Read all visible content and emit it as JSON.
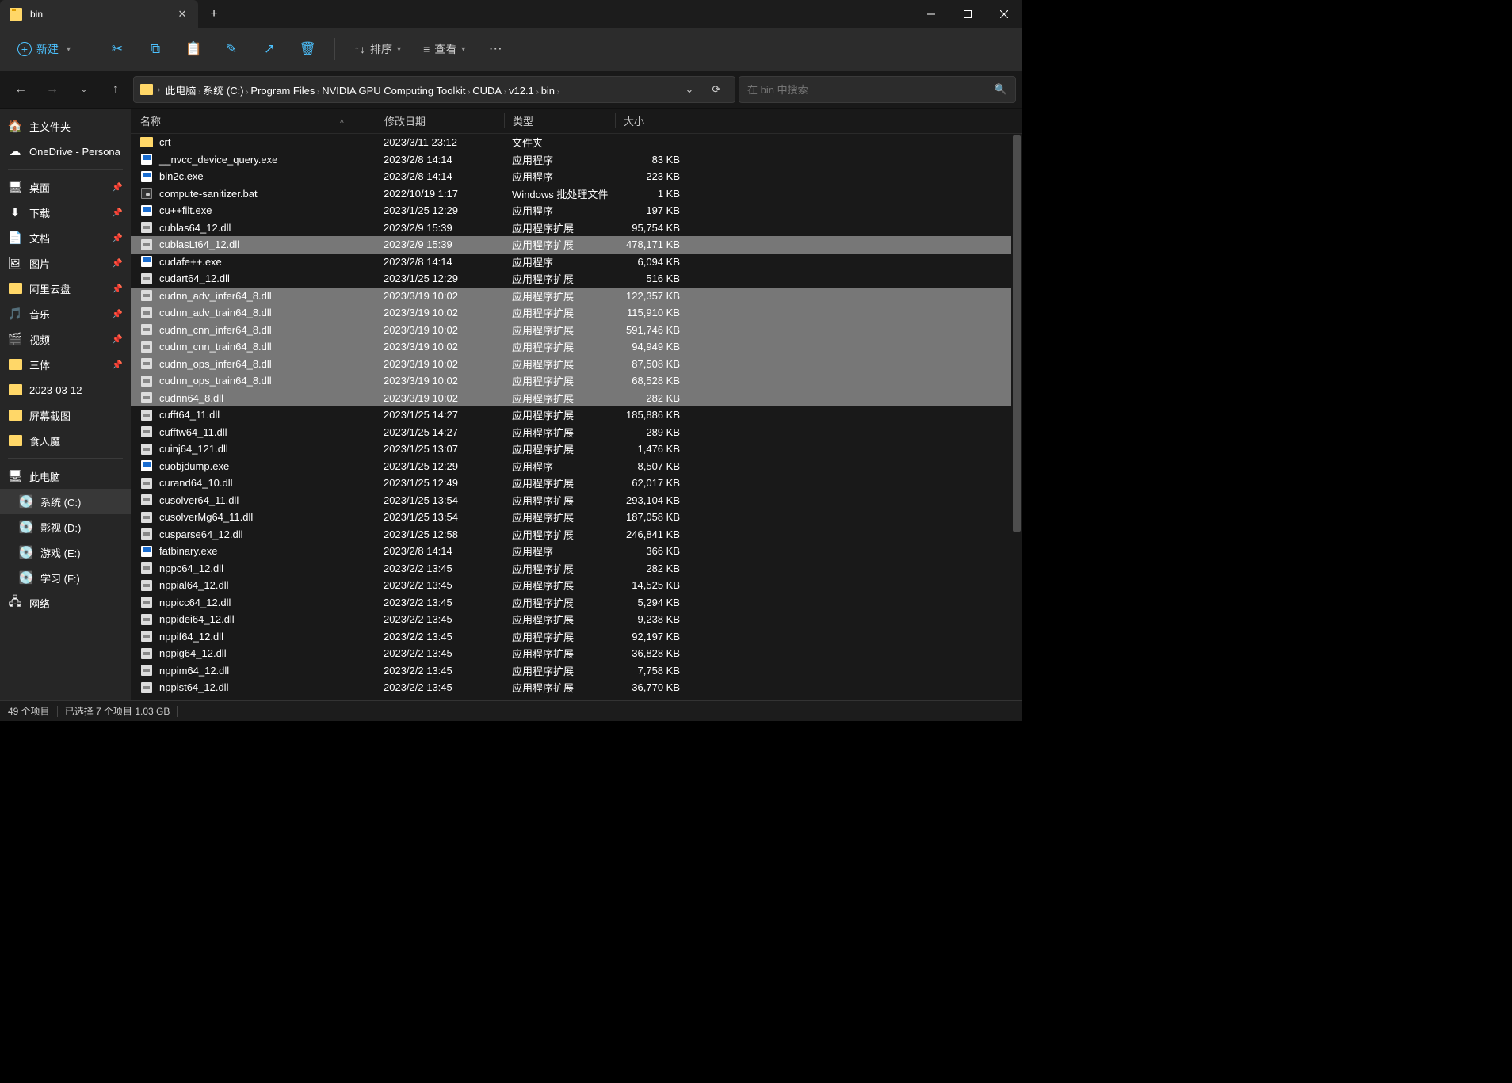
{
  "window": {
    "tab_title": "bin",
    "minimize": "—",
    "maximize": "☐",
    "close": "✕"
  },
  "toolbar": {
    "new_label": "新建",
    "sort_label": "排序",
    "view_label": "查看"
  },
  "breadcrumbs": [
    "此电脑",
    "系统 (C:)",
    "Program Files",
    "NVIDIA GPU Computing Toolkit",
    "CUDA",
    "v12.1",
    "bin"
  ],
  "search": {
    "placeholder": "在 bin 中搜索"
  },
  "sidebar": {
    "top": [
      {
        "label": "主文件夹",
        "icon": "home"
      },
      {
        "label": "OneDrive - Persona",
        "icon": "onedrive"
      }
    ],
    "quick": [
      {
        "label": "桌面",
        "icon": "desktop",
        "pin": true
      },
      {
        "label": "下载",
        "icon": "downloads",
        "pin": true
      },
      {
        "label": "文档",
        "icon": "documents",
        "pin": true
      },
      {
        "label": "图片",
        "icon": "pictures",
        "pin": true
      },
      {
        "label": "阿里云盘",
        "icon": "folder",
        "pin": true
      },
      {
        "label": "音乐",
        "icon": "music",
        "pin": true
      },
      {
        "label": "视频",
        "icon": "videos",
        "pin": true
      },
      {
        "label": "三体",
        "icon": "folder",
        "pin": true
      },
      {
        "label": "2023-03-12",
        "icon": "folder",
        "pin": false
      },
      {
        "label": "屏幕截图",
        "icon": "folder",
        "pin": false
      },
      {
        "label": "食人魔",
        "icon": "folder",
        "pin": false
      }
    ],
    "drives_header": "此电脑",
    "drives": [
      {
        "label": "系统 (C:)",
        "active": true
      },
      {
        "label": "影视 (D:)"
      },
      {
        "label": "游戏 (E:)"
      },
      {
        "label": "学习 (F:)"
      }
    ],
    "network": "网络"
  },
  "columns": {
    "name": "名称",
    "date": "修改日期",
    "type": "类型",
    "size": "大小"
  },
  "files": [
    {
      "name": "crt",
      "date": "2023/3/11 23:12",
      "type": "文件夹",
      "size": "",
      "icon": "folder",
      "sel": false
    },
    {
      "name": "__nvcc_device_query.exe",
      "date": "2023/2/8 14:14",
      "type": "应用程序",
      "size": "83 KB",
      "icon": "exe",
      "sel": false
    },
    {
      "name": "bin2c.exe",
      "date": "2023/2/8 14:14",
      "type": "应用程序",
      "size": "223 KB",
      "icon": "exe",
      "sel": false
    },
    {
      "name": "compute-sanitizer.bat",
      "date": "2022/10/19 1:17",
      "type": "Windows 批处理文件",
      "size": "1 KB",
      "icon": "bat",
      "sel": false
    },
    {
      "name": "cu++filt.exe",
      "date": "2023/1/25 12:29",
      "type": "应用程序",
      "size": "197 KB",
      "icon": "exe",
      "sel": false
    },
    {
      "name": "cublas64_12.dll",
      "date": "2023/2/9 15:39",
      "type": "应用程序扩展",
      "size": "95,754 KB",
      "icon": "dll",
      "sel": false
    },
    {
      "name": "cublasLt64_12.dll",
      "date": "2023/2/9 15:39",
      "type": "应用程序扩展",
      "size": "478,171 KB",
      "icon": "dll",
      "sel": true
    },
    {
      "name": "cudafe++.exe",
      "date": "2023/2/8 14:14",
      "type": "应用程序",
      "size": "6,094 KB",
      "icon": "exe",
      "sel": false
    },
    {
      "name": "cudart64_12.dll",
      "date": "2023/1/25 12:29",
      "type": "应用程序扩展",
      "size": "516 KB",
      "icon": "dll",
      "sel": false
    },
    {
      "name": "cudnn_adv_infer64_8.dll",
      "date": "2023/3/19 10:02",
      "type": "应用程序扩展",
      "size": "122,357 KB",
      "icon": "dll",
      "sel": true
    },
    {
      "name": "cudnn_adv_train64_8.dll",
      "date": "2023/3/19 10:02",
      "type": "应用程序扩展",
      "size": "115,910 KB",
      "icon": "dll",
      "sel": true
    },
    {
      "name": "cudnn_cnn_infer64_8.dll",
      "date": "2023/3/19 10:02",
      "type": "应用程序扩展",
      "size": "591,746 KB",
      "icon": "dll",
      "sel": true
    },
    {
      "name": "cudnn_cnn_train64_8.dll",
      "date": "2023/3/19 10:02",
      "type": "应用程序扩展",
      "size": "94,949 KB",
      "icon": "dll",
      "sel": true
    },
    {
      "name": "cudnn_ops_infer64_8.dll",
      "date": "2023/3/19 10:02",
      "type": "应用程序扩展",
      "size": "87,508 KB",
      "icon": "dll",
      "sel": true
    },
    {
      "name": "cudnn_ops_train64_8.dll",
      "date": "2023/3/19 10:02",
      "type": "应用程序扩展",
      "size": "68,528 KB",
      "icon": "dll",
      "sel": true
    },
    {
      "name": "cudnn64_8.dll",
      "date": "2023/3/19 10:02",
      "type": "应用程序扩展",
      "size": "282 KB",
      "icon": "dll",
      "sel": true
    },
    {
      "name": "cufft64_11.dll",
      "date": "2023/1/25 14:27",
      "type": "应用程序扩展",
      "size": "185,886 KB",
      "icon": "dll",
      "sel": false
    },
    {
      "name": "cufftw64_11.dll",
      "date": "2023/1/25 14:27",
      "type": "应用程序扩展",
      "size": "289 KB",
      "icon": "dll",
      "sel": false
    },
    {
      "name": "cuinj64_121.dll",
      "date": "2023/1/25 13:07",
      "type": "应用程序扩展",
      "size": "1,476 KB",
      "icon": "dll",
      "sel": false
    },
    {
      "name": "cuobjdump.exe",
      "date": "2023/1/25 12:29",
      "type": "应用程序",
      "size": "8,507 KB",
      "icon": "exe",
      "sel": false
    },
    {
      "name": "curand64_10.dll",
      "date": "2023/1/25 12:49",
      "type": "应用程序扩展",
      "size": "62,017 KB",
      "icon": "dll",
      "sel": false
    },
    {
      "name": "cusolver64_11.dll",
      "date": "2023/1/25 13:54",
      "type": "应用程序扩展",
      "size": "293,104 KB",
      "icon": "dll",
      "sel": false
    },
    {
      "name": "cusolverMg64_11.dll",
      "date": "2023/1/25 13:54",
      "type": "应用程序扩展",
      "size": "187,058 KB",
      "icon": "dll",
      "sel": false
    },
    {
      "name": "cusparse64_12.dll",
      "date": "2023/1/25 12:58",
      "type": "应用程序扩展",
      "size": "246,841 KB",
      "icon": "dll",
      "sel": false
    },
    {
      "name": "fatbinary.exe",
      "date": "2023/2/8 14:14",
      "type": "应用程序",
      "size": "366 KB",
      "icon": "exe",
      "sel": false
    },
    {
      "name": "nppc64_12.dll",
      "date": "2023/2/2 13:45",
      "type": "应用程序扩展",
      "size": "282 KB",
      "icon": "dll",
      "sel": false
    },
    {
      "name": "nppial64_12.dll",
      "date": "2023/2/2 13:45",
      "type": "应用程序扩展",
      "size": "14,525 KB",
      "icon": "dll",
      "sel": false
    },
    {
      "name": "nppicc64_12.dll",
      "date": "2023/2/2 13:45",
      "type": "应用程序扩展",
      "size": "5,294 KB",
      "icon": "dll",
      "sel": false
    },
    {
      "name": "nppidei64_12.dll",
      "date": "2023/2/2 13:45",
      "type": "应用程序扩展",
      "size": "9,238 KB",
      "icon": "dll",
      "sel": false
    },
    {
      "name": "nppif64_12.dll",
      "date": "2023/2/2 13:45",
      "type": "应用程序扩展",
      "size": "92,197 KB",
      "icon": "dll",
      "sel": false
    },
    {
      "name": "nppig64_12.dll",
      "date": "2023/2/2 13:45",
      "type": "应用程序扩展",
      "size": "36,828 KB",
      "icon": "dll",
      "sel": false
    },
    {
      "name": "nppim64_12.dll",
      "date": "2023/2/2 13:45",
      "type": "应用程序扩展",
      "size": "7,758 KB",
      "icon": "dll",
      "sel": false
    },
    {
      "name": "nppist64_12.dll",
      "date": "2023/2/2 13:45",
      "type": "应用程序扩展",
      "size": "36,770 KB",
      "icon": "dll",
      "sel": false
    }
  ],
  "status": {
    "items": "49 个项目",
    "selection": "已选择 7 个项目  1.03 GB"
  }
}
